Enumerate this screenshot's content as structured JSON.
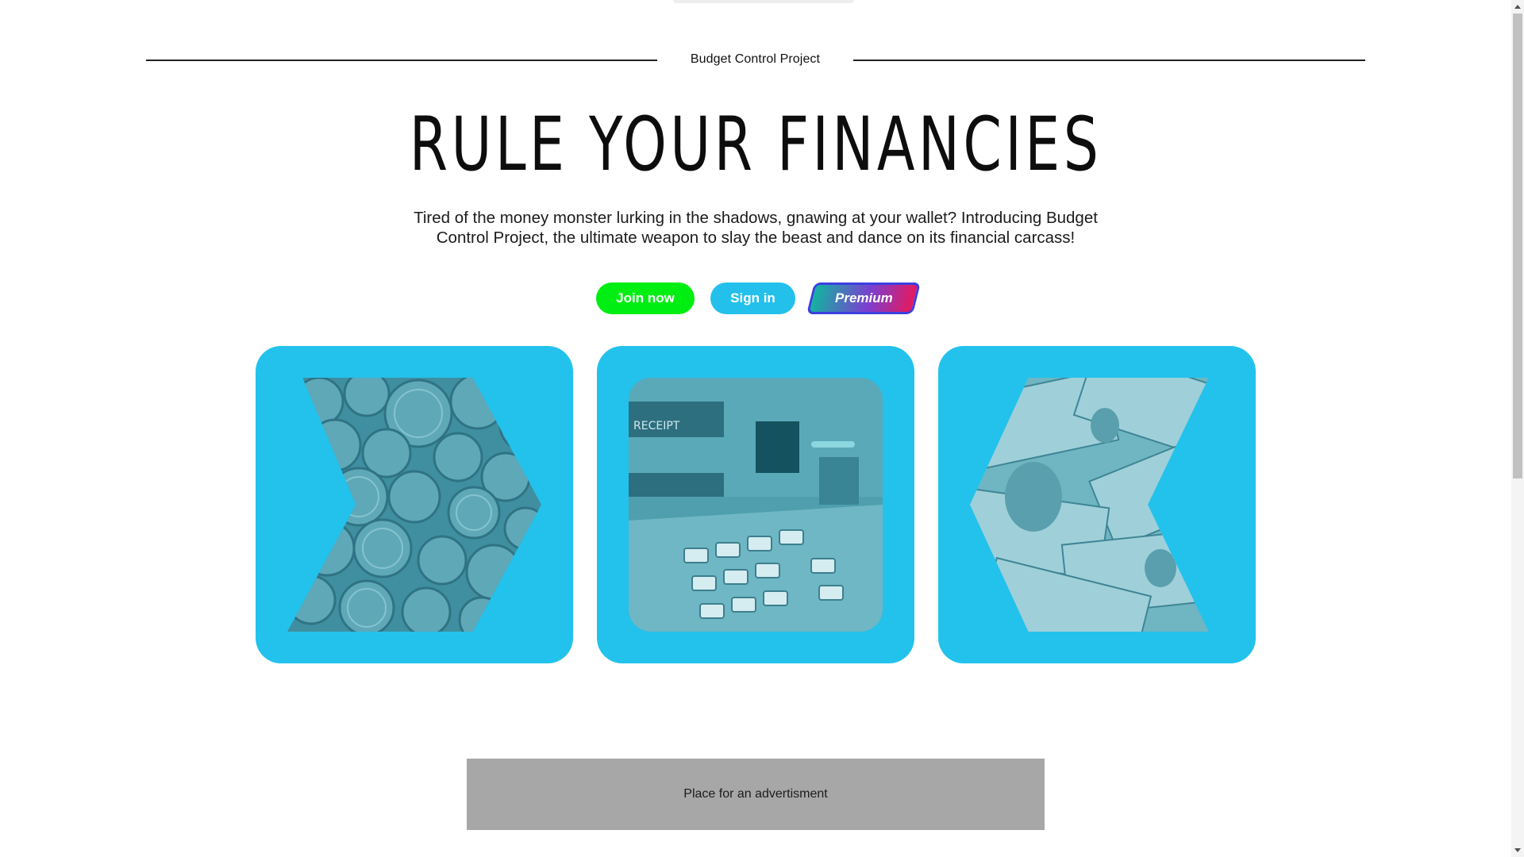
{
  "header": {
    "brand": "Budget Control Project"
  },
  "hero": {
    "title": "RULE YOUR FINANCIES",
    "subtitle": "Tired of the money monster lurking in the shadows, gnawing at your wallet? Introducing Budget Control Project, the ultimate weapon to slay the beast and dance on its financial carcass!"
  },
  "actions": {
    "join_label": "Join now",
    "signin_label": "Sign in",
    "premium_label": "Premium"
  },
  "cards": [
    {
      "icon": "coins-image"
    },
    {
      "icon": "atm-image",
      "receipt_text": "RECEIPT"
    },
    {
      "icon": "banknotes-image"
    }
  ],
  "advertisement": {
    "text": "Place for an advertisment"
  },
  "colors": {
    "accent": "#23c2ec",
    "join": "#00ee12",
    "premium_gradient": [
      "#13b3a1",
      "#7a3fd1",
      "#e5195e"
    ],
    "ad_background": "#a7a7a7"
  }
}
